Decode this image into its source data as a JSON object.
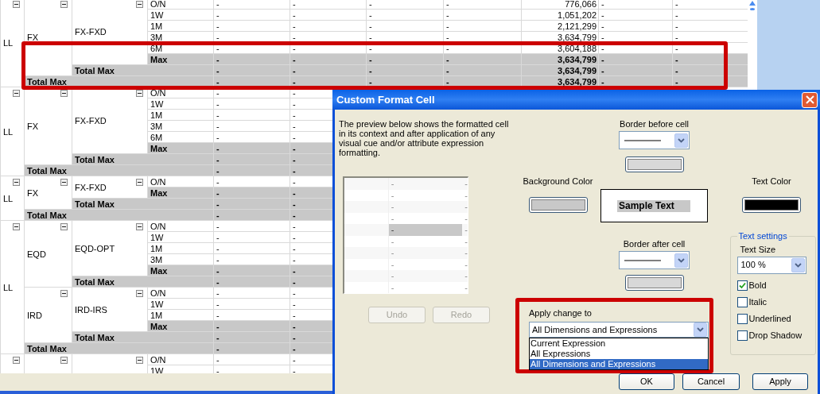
{
  "table": {
    "groups": [
      {
        "label": "LL",
        "expanded": true,
        "children": [
          {
            "label": "FX",
            "expanded": true,
            "children": [
              {
                "label": "FX-FXD",
                "expanded": true,
                "rows": [
                  {
                    "label": "O/N",
                    "kind": "detail",
                    "cells": [
                      "-",
                      "-",
                      "-",
                      "-",
                      "776,066",
                      "-",
                      "-"
                    ]
                  },
                  {
                    "label": "1W",
                    "kind": "detail",
                    "cells": [
                      "-",
                      "-",
                      "-",
                      "-",
                      "1,051,202",
                      "-",
                      "-"
                    ]
                  },
                  {
                    "label": "1M",
                    "kind": "detail",
                    "cells": [
                      "-",
                      "-",
                      "-",
                      "-",
                      "2,121,299",
                      "-",
                      "-"
                    ]
                  },
                  {
                    "label": "3M",
                    "kind": "detail",
                    "cells": [
                      "-",
                      "-",
                      "-",
                      "-",
                      "3,634,799",
                      "-",
                      "-"
                    ]
                  },
                  {
                    "label": "6M",
                    "kind": "detail",
                    "cells": [
                      "-",
                      "-",
                      "-",
                      "-",
                      "3,604,188",
                      "-",
                      "-"
                    ]
                  },
                  {
                    "label": "Max",
                    "kind": "max",
                    "cells": [
                      "-",
                      "-",
                      "-",
                      "-",
                      "3,634,799",
                      "-",
                      "-"
                    ]
                  }
                ]
              }
            ],
            "total": {
              "label": "Total Max",
              "cells": [
                "-",
                "-",
                "-",
                "-",
                "3,634,799",
                "-",
                "-"
              ]
            }
          }
        ],
        "total": {
          "label": "Total Max",
          "cells": [
            "-",
            "-",
            "-",
            "-",
            "3,634,799",
            "-",
            "-"
          ]
        }
      },
      {
        "label": "LL",
        "expanded": true,
        "children": [
          {
            "label": "FX",
            "expanded": true,
            "children": [
              {
                "label": "FX-FXD",
                "expanded": true,
                "rows": [
                  {
                    "label": "O/N",
                    "kind": "detail",
                    "cells": [
                      "-",
                      "-"
                    ]
                  },
                  {
                    "label": "1W",
                    "kind": "detail",
                    "cells": [
                      "-",
                      "-"
                    ]
                  },
                  {
                    "label": "1M",
                    "kind": "detail",
                    "cells": [
                      "-",
                      "-"
                    ]
                  },
                  {
                    "label": "3M",
                    "kind": "detail",
                    "cells": [
                      "-",
                      "-"
                    ]
                  },
                  {
                    "label": "6M",
                    "kind": "detail",
                    "cells": [
                      "-",
                      "-"
                    ]
                  },
                  {
                    "label": "Max",
                    "kind": "max",
                    "cells": [
                      "-",
                      "-"
                    ]
                  }
                ]
              }
            ],
            "total": {
              "label": "Total Max",
              "cells": [
                "-",
                "-"
              ]
            }
          }
        ],
        "total": {
          "label": "Total Max",
          "cells": [
            "-",
            "-"
          ]
        }
      },
      {
        "label": "LL",
        "expanded": true,
        "children": [
          {
            "label": "FX",
            "expanded": true,
            "children": [
              {
                "label": "FX-FXD",
                "expanded": true,
                "rows": [
                  {
                    "label": "O/N",
                    "kind": "detail",
                    "cells": [
                      "-",
                      "-"
                    ]
                  },
                  {
                    "label": "Max",
                    "kind": "max",
                    "cells": [
                      "-",
                      "-"
                    ]
                  }
                ]
              }
            ],
            "total": {
              "label": "Total Max",
              "cells": [
                "-",
                "-"
              ]
            }
          }
        ],
        "total": {
          "label": "Total Max",
          "cells": [
            "-",
            "-"
          ]
        }
      },
      {
        "label": "LL",
        "expanded": true,
        "children": [
          {
            "label": "EQD",
            "expanded": true,
            "children": [
              {
                "label": "EQD-OPT",
                "expanded": true,
                "rows": [
                  {
                    "label": "O/N",
                    "kind": "detail",
                    "cells": [
                      "-",
                      "-"
                    ]
                  },
                  {
                    "label": "1W",
                    "kind": "detail",
                    "cells": [
                      "-",
                      "-"
                    ]
                  },
                  {
                    "label": "1M",
                    "kind": "detail",
                    "cells": [
                      "-",
                      "-"
                    ]
                  },
                  {
                    "label": "3M",
                    "kind": "detail",
                    "cells": [
                      "-",
                      "-"
                    ]
                  },
                  {
                    "label": "Max",
                    "kind": "max",
                    "cells": [
                      "-",
                      "-"
                    ]
                  }
                ]
              }
            ],
            "total": {
              "label": "Total Max",
              "cells": [
                "-",
                "-"
              ]
            }
          },
          {
            "label": "IRD",
            "expanded": true,
            "children": [
              {
                "label": "IRD-IRS",
                "expanded": true,
                "rows": [
                  {
                    "label": "O/N",
                    "kind": "detail",
                    "cells": [
                      "-",
                      "-"
                    ]
                  },
                  {
                    "label": "1W",
                    "kind": "detail",
                    "cells": [
                      "-",
                      "-"
                    ]
                  },
                  {
                    "label": "1M",
                    "kind": "detail",
                    "cells": [
                      "-",
                      "-"
                    ]
                  },
                  {
                    "label": "Max",
                    "kind": "max",
                    "cells": [
                      "-",
                      "-"
                    ]
                  }
                ]
              }
            ],
            "total": {
              "label": "Total Max",
              "cells": [
                "-",
                "-"
              ]
            }
          }
        ],
        "total": {
          "label": "Total Max",
          "cells": [
            "-",
            "-"
          ]
        }
      },
      {
        "expanded": true,
        "children": [
          {
            "expanded": true,
            "children": [
              {
                "expanded": true,
                "rows": [
                  {
                    "label": "O/N",
                    "kind": "detail",
                    "cells": [
                      "-",
                      "-"
                    ]
                  },
                  {
                    "label": "1W",
                    "kind": "detail",
                    "cells": [
                      "-",
                      "-"
                    ]
                  }
                ]
              }
            ]
          }
        ]
      }
    ]
  },
  "dialog": {
    "title": "Custom Format Cell",
    "description": "The preview below shows the formatted cell in its context and after application of any visual cue and/or attribute expression formatting.",
    "preview": {
      "rows": [
        {
          "cells": [
            "-",
            "-"
          ],
          "selected": false
        },
        {
          "cells": [
            "-",
            "-"
          ],
          "selected": false
        },
        {
          "cells": [
            "-",
            "-"
          ],
          "selected": false
        },
        {
          "cells": [
            "-",
            "-"
          ],
          "selected": false
        },
        {
          "cells": [
            "-",
            "-"
          ],
          "selected": true
        },
        {
          "cells": [
            "-",
            "-"
          ],
          "selected": false
        },
        {
          "cells": [
            "-",
            "-"
          ],
          "selected": false
        },
        {
          "cells": [
            "-",
            "-"
          ],
          "selected": false
        },
        {
          "cells": [
            "-",
            "-"
          ],
          "selected": false
        },
        {
          "cells": [
            "-",
            "-"
          ],
          "selected": false
        }
      ]
    },
    "undo": {
      "label": "Undo",
      "disabled": true
    },
    "redo": {
      "label": "Redo",
      "disabled": true
    },
    "border_before": {
      "label": "Border before cell"
    },
    "background_color": {
      "label": "Background Color",
      "color": "#c8c8c8"
    },
    "sample_text": "Sample Text",
    "border_after": {
      "label": "Border after cell"
    },
    "text_color": {
      "label": "Text Color",
      "color": "#000000"
    },
    "text_settings": {
      "title": "Text settings",
      "size_label": "Text Size",
      "size": "100 %",
      "options": [
        {
          "label": "Bold",
          "checked": true
        },
        {
          "label": "Italic",
          "checked": false
        },
        {
          "label": "Underlined",
          "checked": false
        },
        {
          "label": "Drop Shadow",
          "checked": false
        }
      ]
    },
    "apply_change": {
      "label": "Apply change to",
      "value": "All Dimensions and Expressions",
      "options": [
        {
          "label": "Current Expression",
          "selected": false
        },
        {
          "label": "All Expressions",
          "selected": false
        },
        {
          "label": "All Dimensions and Expressions",
          "selected": true
        }
      ]
    },
    "buttons": [
      "OK",
      "Cancel",
      "Apply"
    ]
  }
}
